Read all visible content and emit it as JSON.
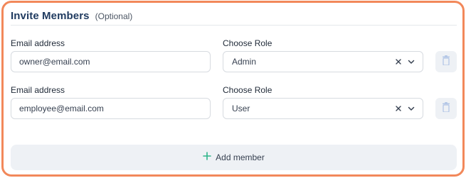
{
  "header": {
    "title": "Invite Members",
    "subtitle": "(Optional)"
  },
  "members": [
    {
      "email_label": "Email address",
      "email_value": "owner@email.com",
      "role_label": "Choose Role",
      "role_value": "Admin"
    },
    {
      "email_label": "Email address",
      "email_value": "employee@email.com",
      "role_label": "Choose Role",
      "role_value": "User"
    }
  ],
  "add_button": {
    "label": "Add member"
  },
  "icons": {
    "clear": "x-icon",
    "dropdown": "chevron-down-icon",
    "delete": "trash-icon",
    "add": "plus-icon"
  },
  "colors": {
    "border_accent": "#f2885a",
    "title": "#1f3a5f",
    "plus_green": "#2fb58a",
    "trash_blue": "#b3c6e6"
  }
}
